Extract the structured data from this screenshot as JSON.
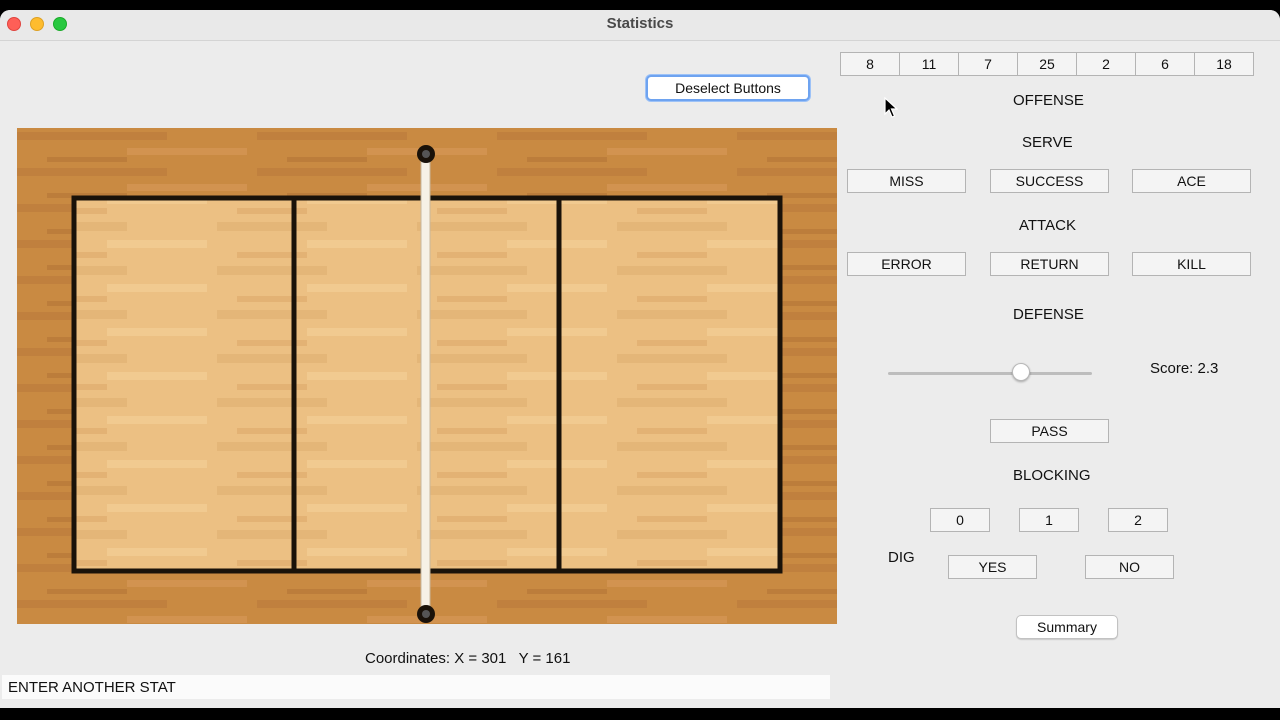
{
  "window": {
    "title": "Statistics"
  },
  "player_numbers": [
    "8",
    "11",
    "7",
    "25",
    "2",
    "6",
    "18"
  ],
  "deselect_label": "Deselect Buttons",
  "offense": {
    "heading": "OFFENSE",
    "serve": {
      "label": "SERVE",
      "buttons": [
        "MISS",
        "SUCCESS",
        "ACE"
      ]
    },
    "attack": {
      "label": "ATTACK",
      "buttons": [
        "ERROR",
        "RETURN",
        "KILL"
      ]
    }
  },
  "defense": {
    "heading": "DEFENSE",
    "score_text": "Score: 2.3",
    "slider_fraction": 0.65,
    "pass_label": "PASS"
  },
  "blocking": {
    "label": "BLOCKING",
    "buttons": [
      "0",
      "1",
      "2"
    ]
  },
  "dig": {
    "label": "DIG",
    "yes": "YES",
    "no": "NO"
  },
  "summary_label": "Summary",
  "coordinates_text": "Coordinates: X = 301   Y = 161",
  "stat_input": {
    "value": "ENTER ANOTHER STAT"
  },
  "colors": {
    "floor": "#c98a42",
    "court": "#ecc083",
    "lines": "#1a1209",
    "focus": "#6ea3f0"
  }
}
